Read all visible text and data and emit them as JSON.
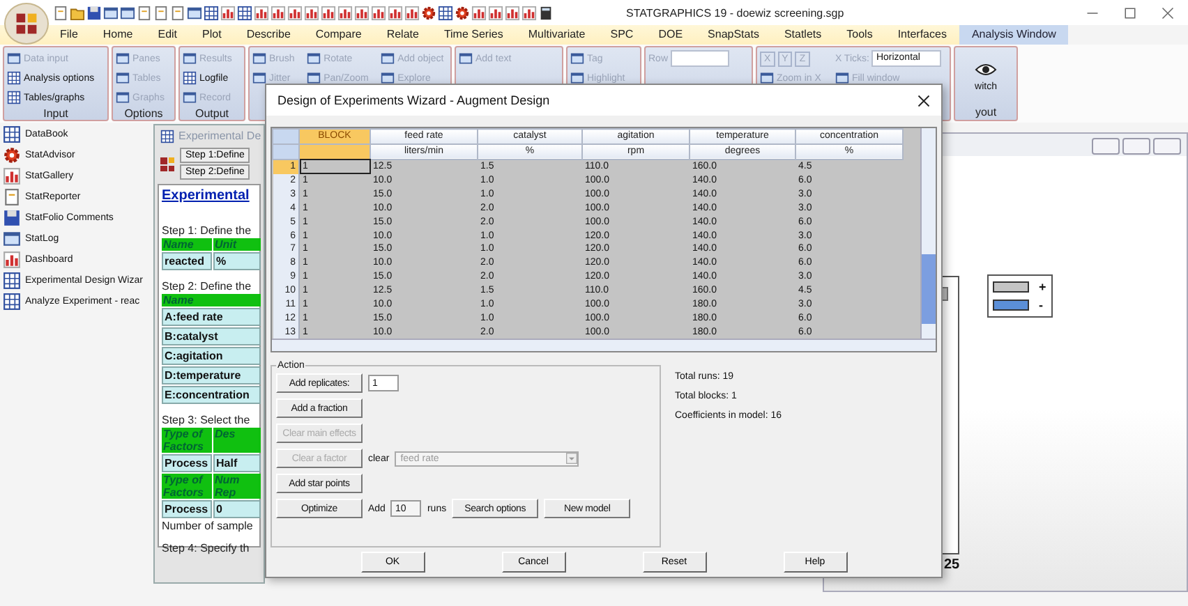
{
  "app": {
    "title": "STATGRAPHICS 19 - doewiz screening.sgp"
  },
  "menu": [
    {
      "label": "File",
      "selected": false
    },
    {
      "label": "Home",
      "selected": false
    },
    {
      "label": "Edit",
      "selected": false
    },
    {
      "label": "Plot",
      "selected": false
    },
    {
      "label": "Describe",
      "selected": false
    },
    {
      "label": "Compare",
      "selected": false
    },
    {
      "label": "Relate",
      "selected": false
    },
    {
      "label": "Time Series",
      "selected": false
    },
    {
      "label": "Multivariate",
      "selected": false
    },
    {
      "label": "SPC",
      "selected": false
    },
    {
      "label": "DOE",
      "selected": false
    },
    {
      "label": "SnapStats",
      "selected": false
    },
    {
      "label": "Statlets",
      "selected": false
    },
    {
      "label": "Tools",
      "selected": false
    },
    {
      "label": "Interfaces",
      "selected": false
    },
    {
      "label": "Analysis Window",
      "selected": true
    }
  ],
  "ribbon": [
    {
      "label": "Input",
      "items": [
        {
          "kind": "item",
          "label": "Data input",
          "disabled": true
        },
        {
          "kind": "item",
          "label": "Analysis options",
          "disabled": false
        },
        {
          "kind": "item",
          "label": "Tables/graphs",
          "disabled": false
        }
      ]
    },
    {
      "label": "Options",
      "items": [
        {
          "kind": "item",
          "label": "Panes",
          "disabled": true
        },
        {
          "kind": "item",
          "label": "Tables",
          "disabled": true
        },
        {
          "kind": "item",
          "label": "Graphs",
          "disabled": true
        }
      ]
    },
    {
      "label": "Output",
      "items": [
        {
          "kind": "item",
          "label": "Results",
          "disabled": true
        },
        {
          "kind": "item",
          "label": "Logfile",
          "disabled": false
        },
        {
          "kind": "item",
          "label": "Record",
          "disabled": true
        }
      ]
    },
    {
      "items": [
        {
          "kind": "item",
          "label": "Brush",
          "disabled": true
        },
        {
          "kind": "item",
          "label": "Rotate",
          "disabled": true
        },
        {
          "kind": "item",
          "label": "Add object",
          "disabled": true
        },
        {
          "kind": "item",
          "label": "Jitter",
          "disabled": true
        },
        {
          "kind": "item",
          "label": "Pan/Zoom",
          "disabled": true
        },
        {
          "kind": "item",
          "label": "Explore",
          "disabled": true
        }
      ]
    },
    {
      "items": [
        {
          "kind": "item",
          "label": "Add text",
          "disabled": true
        }
      ]
    },
    {
      "items": [
        {
          "kind": "item",
          "label": "Tag",
          "disabled": true
        },
        {
          "kind": "item",
          "label": "Highlight",
          "disabled": true
        }
      ]
    },
    {
      "items": [
        {
          "kind": "field",
          "label": "Row",
          "disabled": true
        }
      ]
    },
    {
      "items": [
        {
          "kind": "axes",
          "labels": [
            "X",
            "Y",
            "Z"
          ],
          "disabled": true
        },
        {
          "kind": "dropdown",
          "label": "X Ticks:",
          "value": "Horizontal",
          "disabled": true
        },
        {
          "kind": "item",
          "label": "Zoom in X",
          "disabled": true
        },
        {
          "kind": "item",
          "label": "Fill window",
          "disabled": true
        }
      ]
    },
    {
      "label": "yout",
      "items": [
        {
          "kind": "large",
          "label": "witch",
          "disabled": false
        }
      ]
    }
  ],
  "sidebar": {
    "items": [
      "DataBook",
      "StatAdvisor",
      "StatGallery",
      "StatReporter",
      "StatFolio Comments",
      "StatLog",
      "Dashboard",
      "Experimental Design Wizar",
      "Analyze Experiment - reac"
    ]
  },
  "wizard_window": {
    "title": "Experimental De",
    "steps": [
      "Step 1:Define",
      "Step 2:Define"
    ],
    "heading": "Experimental",
    "sections": [
      {
        "kind": "text",
        "text": "Step 1: Define the"
      },
      {
        "kind": "table",
        "header": [
          "Name",
          "Unit"
        ],
        "rows": [
          [
            "reacted",
            "%"
          ]
        ]
      },
      {
        "kind": "text",
        "text": "Step 2: Define the"
      },
      {
        "kind": "table",
        "header": [
          "Name"
        ],
        "rows": [
          [
            "A:feed rate"
          ],
          [
            "B:catalyst"
          ],
          [
            "C:agitation"
          ],
          [
            "D:temperature"
          ],
          [
            "E:concentration"
          ]
        ]
      },
      {
        "kind": "text",
        "text": "Step 3: Select the"
      },
      {
        "kind": "table",
        "header": [
          "Type of Factors",
          "Des"
        ],
        "rows": [
          [
            "Process",
            "Half"
          ]
        ]
      },
      {
        "kind": "table",
        "header": [
          "Type of Factors",
          "Num Rep"
        ],
        "rows": [
          [
            "Process",
            "0"
          ]
        ]
      },
      {
        "kind": "note",
        "text": "Number of sample"
      },
      {
        "kind": "text",
        "text": "Step 4: Specify th"
      }
    ]
  },
  "plot_window": {
    "axis_label": "25",
    "legend": [
      {
        "label": "+",
        "color": "#c4c4c4"
      },
      {
        "label": "-",
        "color": "#5b8fd8"
      }
    ]
  },
  "dialog": {
    "title": "Design of Experiments Wizard - Augment Design",
    "table": {
      "columns": [
        {
          "name": "BLOCK",
          "selected": true
        },
        {
          "name": "feed rate",
          "unit": "liters/min",
          "selected": false
        },
        {
          "name": "catalyst",
          "unit": "%",
          "selected": false
        },
        {
          "name": "agitation",
          "unit": "rpm",
          "selected": false
        },
        {
          "name": "temperature",
          "unit": "degrees",
          "selected": false
        },
        {
          "name": "concentration",
          "unit": "%",
          "selected": false
        }
      ],
      "rows": [
        {
          "number": "1",
          "selected": true,
          "cells": [
            "1",
            "12.5",
            "1.5",
            "110.0",
            "160.0",
            "4.5"
          ]
        },
        {
          "number": "2",
          "selected": false,
          "cells": [
            "1",
            "10.0",
            "1.0",
            "100.0",
            "140.0",
            "6.0"
          ]
        },
        {
          "number": "3",
          "selected": false,
          "cells": [
            "1",
            "15.0",
            "1.0",
            "100.0",
            "140.0",
            "3.0"
          ]
        },
        {
          "number": "4",
          "selected": false,
          "cells": [
            "1",
            "10.0",
            "2.0",
            "100.0",
            "140.0",
            "3.0"
          ]
        },
        {
          "number": "5",
          "selected": false,
          "cells": [
            "1",
            "15.0",
            "2.0",
            "100.0",
            "140.0",
            "6.0"
          ]
        },
        {
          "number": "6",
          "selected": false,
          "cells": [
            "1",
            "10.0",
            "1.0",
            "120.0",
            "140.0",
            "3.0"
          ]
        },
        {
          "number": "7",
          "selected": false,
          "cells": [
            "1",
            "15.0",
            "1.0",
            "120.0",
            "140.0",
            "6.0"
          ]
        },
        {
          "number": "8",
          "selected": false,
          "cells": [
            "1",
            "10.0",
            "2.0",
            "120.0",
            "140.0",
            "6.0"
          ]
        },
        {
          "number": "9",
          "selected": false,
          "cells": [
            "1",
            "15.0",
            "2.0",
            "120.0",
            "140.0",
            "3.0"
          ]
        },
        {
          "number": "10",
          "selected": false,
          "cells": [
            "1",
            "12.5",
            "1.5",
            "110.0",
            "160.0",
            "4.5"
          ]
        },
        {
          "number": "11",
          "selected": false,
          "cells": [
            "1",
            "10.0",
            "1.0",
            "100.0",
            "180.0",
            "3.0"
          ]
        },
        {
          "number": "12",
          "selected": false,
          "cells": [
            "1",
            "15.0",
            "1.0",
            "100.0",
            "180.0",
            "6.0"
          ]
        },
        {
          "number": "13",
          "selected": false,
          "cells": [
            "1",
            "10.0",
            "2.0",
            "100.0",
            "180.0",
            "6.0"
          ]
        }
      ]
    },
    "action_label": "Action",
    "actions": [
      {
        "kind": "button-field",
        "label": "Add replicates:",
        "value": "1",
        "disabled": false
      },
      {
        "kind": "button",
        "label": "Add a fraction",
        "disabled": false
      },
      {
        "kind": "button",
        "label": "Clear main effects",
        "disabled": true
      },
      {
        "kind": "button-select",
        "label": "Clear a factor",
        "disabled": true,
        "select_label": "clear",
        "select_value": "feed rate"
      },
      {
        "kind": "button",
        "label": "Add star points",
        "disabled": false
      },
      {
        "kind": "optimize",
        "label": "Optimize",
        "disabled": false,
        "add_label": "Add",
        "value": "10",
        "unit": "runs",
        "buttons": [
          "Search options",
          "New model"
        ]
      }
    ],
    "summary": [
      "Total runs: 19",
      "Total blocks: 1",
      "Coefficients in model: 16"
    ],
    "buttons": [
      "OK",
      "Cancel",
      "Reset",
      "Help"
    ]
  }
}
